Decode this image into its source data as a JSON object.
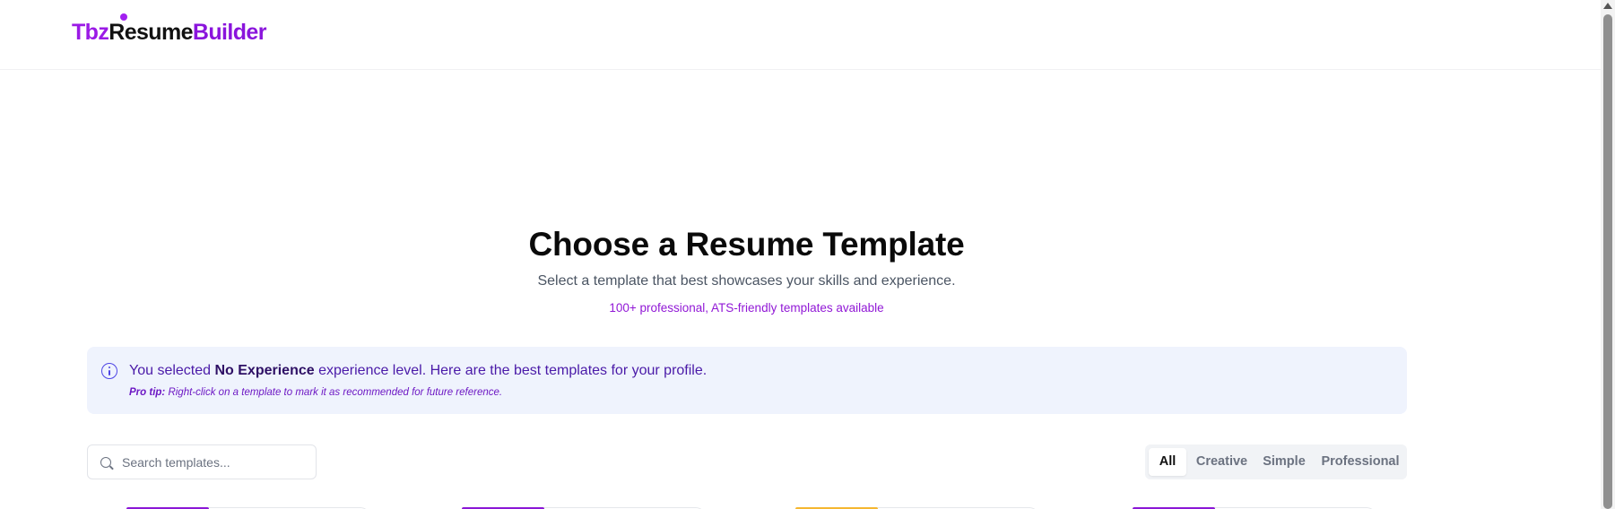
{
  "header": {
    "logo_part1": "Tbz",
    "logo_part2": "Resume",
    "logo_part3": "Builder"
  },
  "hero": {
    "title": "Choose a Resume Template",
    "subtitle": "Select a template that best showcases your skills and experience.",
    "count_text": "100+ professional, ATS-friendly templates available"
  },
  "info": {
    "prefix": "You selected ",
    "level": "No Experience",
    "suffix": " experience level. Here are the best templates for your profile.",
    "tip_label": "Pro tip:",
    "tip_text": " Right-click on a template to mark it as recommended for future reference."
  },
  "search": {
    "placeholder": "Search templates...",
    "value": ""
  },
  "filters": {
    "tabs": [
      "All",
      "Creative",
      "Simple",
      "Professional"
    ],
    "active": "All"
  },
  "cards": {
    "accent_colors": [
      "#8b17d6",
      "#8b17d6",
      "#f5b731",
      "#8b17d6"
    ]
  },
  "colors": {
    "brand_purple": "#9b1ae6",
    "info_bg": "#eff3fd",
    "info_icon": "#4f46e5"
  }
}
